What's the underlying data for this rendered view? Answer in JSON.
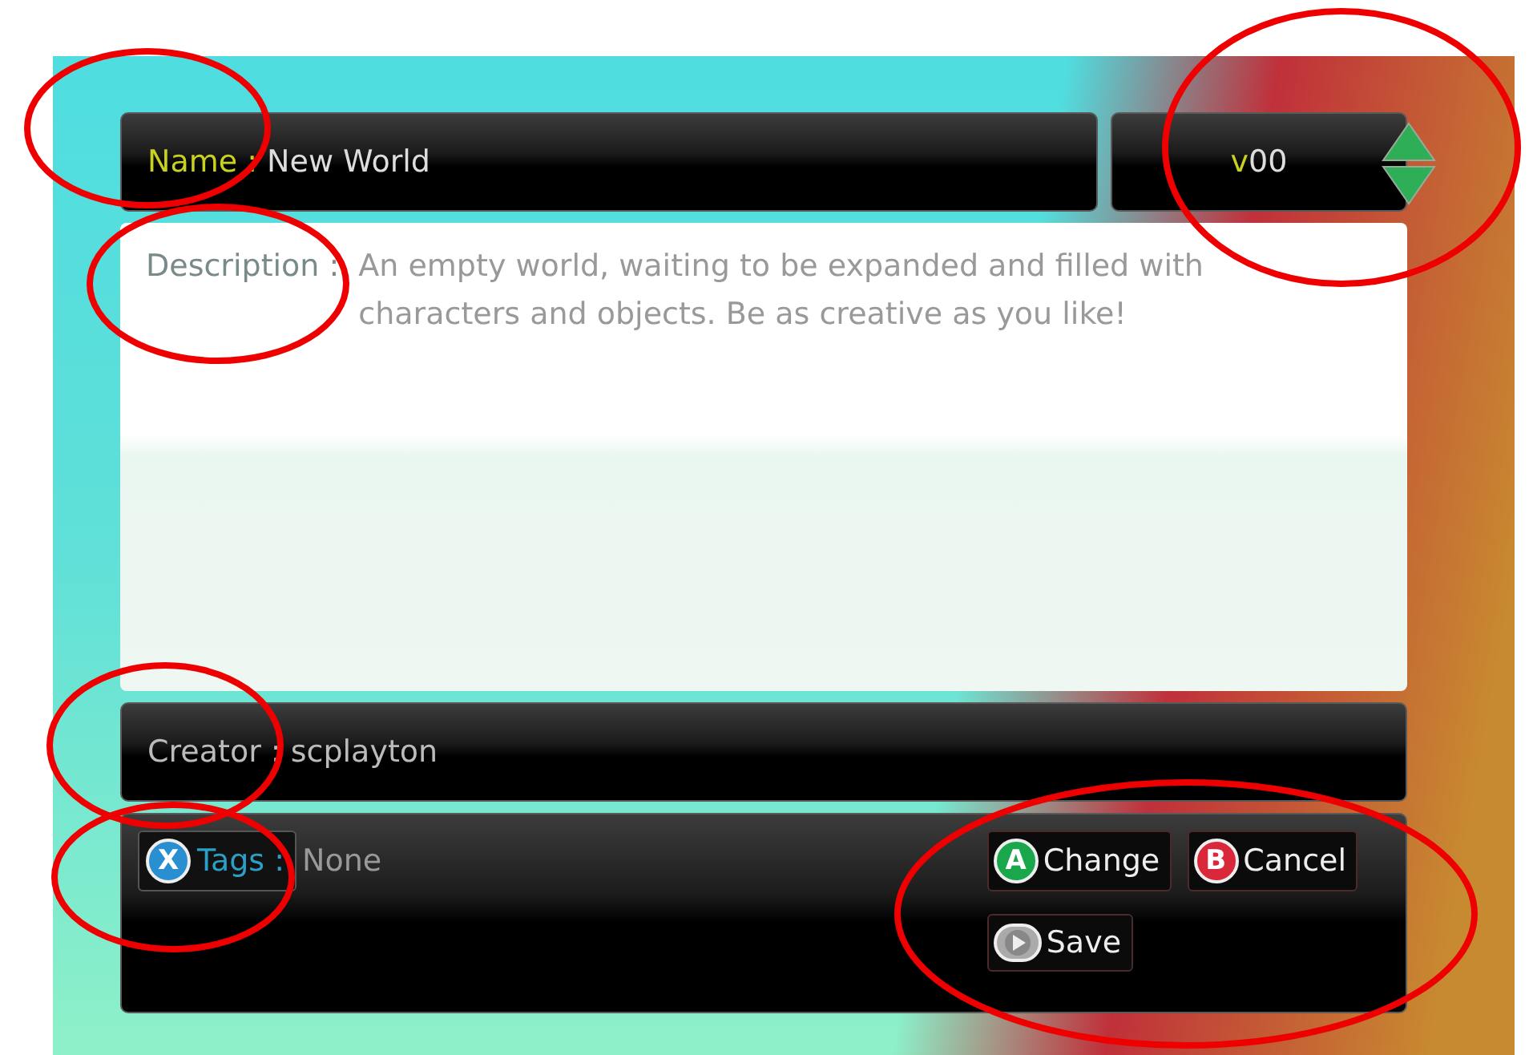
{
  "name": {
    "label": "Name :",
    "value": "New World"
  },
  "version": {
    "prefix": "v",
    "value": "00"
  },
  "description": {
    "label": "Description :",
    "text": "An empty world, waiting to be expanded and filled with characters and objects. Be as creative as you like!"
  },
  "creator": {
    "label": "Creator :",
    "value": "scplayton"
  },
  "tags": {
    "glyph": "X",
    "label": "Tags :",
    "value": "None"
  },
  "actions": [
    {
      "kind": "a",
      "glyph": "A",
      "label": "Change"
    },
    {
      "kind": "b",
      "glyph": "B",
      "label": "Cancel"
    },
    {
      "kind": "play",
      "label": "Save"
    }
  ]
}
